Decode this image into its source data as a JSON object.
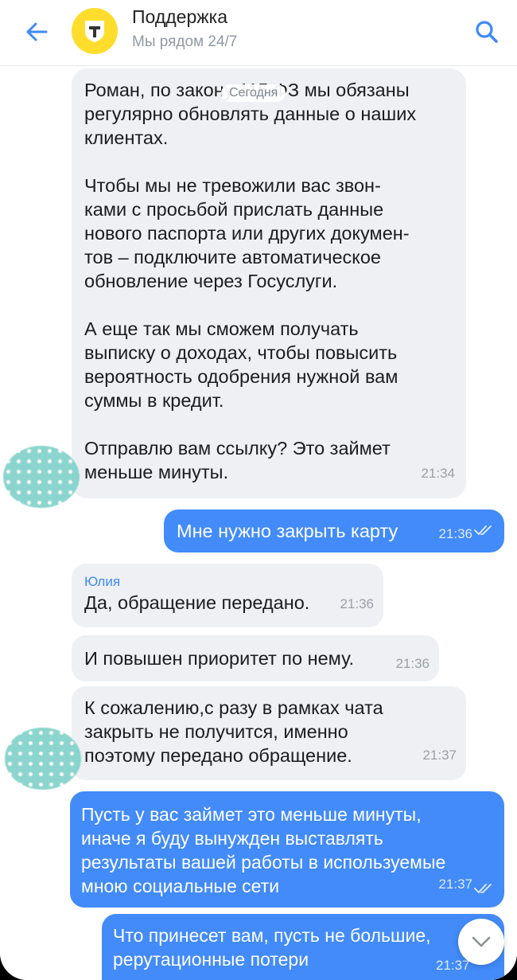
{
  "header": {
    "title": "Поддержка",
    "subtitle": "Мы рядом 24/7",
    "avatar_letter": "т",
    "back_icon": "arrow-left-icon",
    "search_icon": "search-icon",
    "accent": "#3d8af7",
    "avatar_color": "#ffdd2d"
  },
  "date_pill": "Сегодня",
  "messages": [
    {
      "direction": "in",
      "paragraphs": [
        "Роман, по закону 115 ФЗ мы обязаны\nрегулярно обновлять данные о наших\nклиентах.",
        "Чтобы мы не тревожили вас звон-\nками с просьбой прислать данные\nнового паспорта или других докумен-\nтов – подключите автоматическое\nобновление через Госуслуги.",
        "А еще так мы сможем получать\nвыписку о доходах, чтобы повысить\nвероятность одобрения нужной вам\nсуммы в кредит.",
        "Отправлю вам ссылку? Это займет\nменьше минуты."
      ],
      "time": "21:34"
    },
    {
      "direction": "out",
      "text": "Мне нужно закрыть карту",
      "time": "21:36",
      "status": "double-check-icon"
    },
    {
      "direction": "in",
      "sender": "Юлия",
      "text": "Да, обращение передано.",
      "time": "21:36"
    },
    {
      "direction": "in",
      "text": "И повышен приоритет по нему.",
      "time": "21:36"
    },
    {
      "direction": "in",
      "text": "К сожалению,с разу в рамках чата\nзакрыть не получится, именно\nпоэтому передано обращение.",
      "time": "21:37"
    },
    {
      "direction": "out",
      "text": "Пусть у вас займет это меньше минуты,\nиначе я буду вынужден выставлять\nрезультаты вашей работы в используемые\nмною социальные сети",
      "time": "21:37",
      "status": "double-check-icon"
    },
    {
      "direction": "out",
      "text": "Что принесет вам, пусть не большие,\nрерутационные потери",
      "time": "21:37"
    }
  ],
  "colors": {
    "incoming_bubble": "#eef0f3",
    "outgoing_bubble": "#428bf9"
  }
}
